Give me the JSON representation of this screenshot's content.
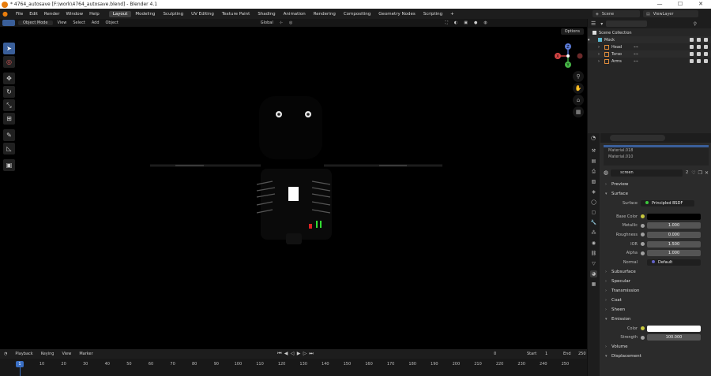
{
  "window": {
    "title": "* 4764_autosave [F:\\work\\4764_autosave.blend] - Blender 4.1",
    "controls": [
      "—",
      "☐",
      "✕"
    ]
  },
  "menubar": {
    "menus": [
      "File",
      "Edit",
      "Render",
      "Window",
      "Help"
    ],
    "workspaces": [
      "Layout",
      "Modeling",
      "Sculpting",
      "UV Editing",
      "Texture Paint",
      "Shading",
      "Animation",
      "Rendering",
      "Compositing",
      "Geometry Nodes",
      "Scripting"
    ],
    "active_workspace": "Layout",
    "add_tab": "+",
    "scene": "Scene",
    "view_layer": "ViewLayer"
  },
  "viewport_header": {
    "mode": "Object Mode",
    "menus": [
      "View",
      "Select",
      "Add",
      "Object"
    ],
    "transform": "Global",
    "options": "Options"
  },
  "toolbar": {
    "tools": [
      "select-box",
      "cursor",
      "move",
      "rotate",
      "scale",
      "transform",
      "annotate",
      "measure",
      "add-cube"
    ]
  },
  "gizmo": {
    "x": "X",
    "y": "Y",
    "z": "Z"
  },
  "timeline": {
    "menus": [
      "Playback",
      "Keying",
      "View",
      "Marker"
    ],
    "current_frame": "0",
    "start_label": "Start",
    "start": "1",
    "end_label": "End",
    "end": "250",
    "playhead": "1",
    "ticks": [
      "10",
      "20",
      "30",
      "40",
      "50",
      "60",
      "70",
      "80",
      "90",
      "100",
      "110",
      "120",
      "130",
      "140",
      "150",
      "160",
      "170",
      "180",
      "190",
      "200",
      "210",
      "220",
      "230",
      "240",
      "250"
    ]
  },
  "outliner": {
    "root": "Scene Collection",
    "collection": "Mock",
    "items": [
      "Head",
      "Torso",
      "Arms"
    ]
  },
  "properties": {
    "slots": [
      "Material.018",
      "Material.010"
    ],
    "material_name": "screen",
    "users": "2",
    "sections": {
      "preview": "Preview",
      "surface": "Surface",
      "subsurface": "Subsurface",
      "specular": "Specular",
      "transmission": "Transmission",
      "coat": "Coat",
      "sheen": "Sheen",
      "emission": "Emission",
      "volume": "Volume",
      "displacement": "Displacement"
    },
    "surface_label": "Surface",
    "surface_value": "Principled BSDF",
    "fields": [
      {
        "label": "Base Color",
        "value": "",
        "kind": "color-black"
      },
      {
        "label": "Metallic",
        "value": "1.000",
        "kind": "num"
      },
      {
        "label": "Roughness",
        "value": "0.000",
        "kind": "num"
      },
      {
        "label": "IOR",
        "value": "1.500",
        "kind": "num"
      },
      {
        "label": "Alpha",
        "value": "1.000",
        "kind": "num"
      },
      {
        "label": "Normal",
        "value": "Default",
        "kind": "link"
      }
    ],
    "emission": {
      "color_label": "Color",
      "strength_label": "Strength",
      "strength_value": "100.000"
    }
  }
}
